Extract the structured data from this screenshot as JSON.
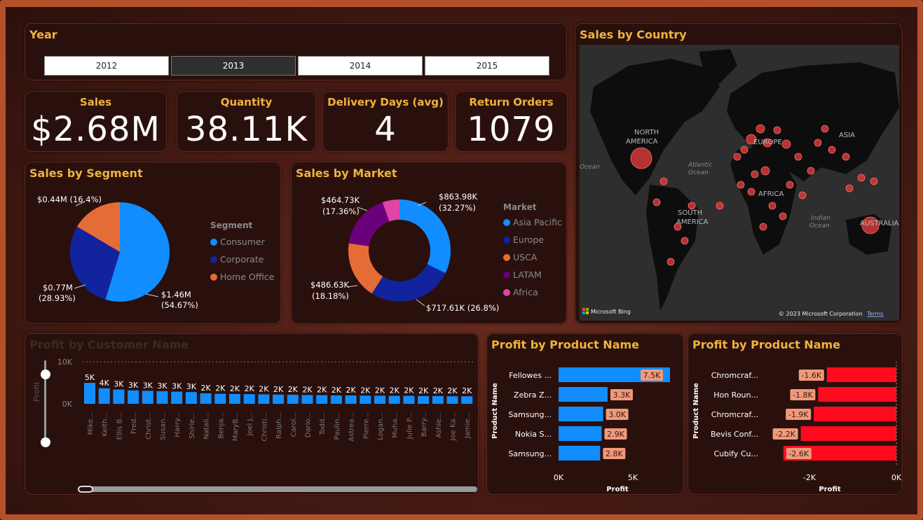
{
  "year_slicer": {
    "title": "Year",
    "options": [
      "2012",
      "2013",
      "2014",
      "2015"
    ],
    "selected": "2013"
  },
  "kpis": {
    "sales": {
      "label": "Sales",
      "value": "$2.68M"
    },
    "quantity": {
      "label": "Quantity",
      "value": "38.11K"
    },
    "delivery": {
      "label": "Delivery Days (avg)",
      "value": "4"
    },
    "returns": {
      "label": "Return Orders",
      "value": "1079"
    }
  },
  "segment": {
    "title": "Sales by Segment",
    "legend_title": "Segment",
    "legend": [
      "Consumer",
      "Corporate",
      "Home Office"
    ],
    "labels": {
      "consumer": [
        "$1.46M",
        "(54.67%)"
      ],
      "corporate": [
        "$0.77M",
        "(28.93%)"
      ],
      "home_office": "$0.44M (16.4%)"
    }
  },
  "market": {
    "title": "Sales by Market",
    "legend_title": "Market",
    "legend": [
      "Asia Pacific",
      "Europe",
      "USCA",
      "LATAM",
      "Africa"
    ],
    "labels": {
      "asia_pacific": [
        "$863.98K",
        "(32.27%)"
      ],
      "europe": "$717.61K (26.8%)",
      "usca": [
        "$486.63K",
        "(18.18%)"
      ],
      "latam": [
        "$464.73K",
        "(17.36%)"
      ]
    }
  },
  "map": {
    "title": "Sales by Country",
    "continents": [
      "NORTH",
      "AMERICA",
      "EUROPE",
      "ASIA",
      "AFRICA",
      "SOUTH",
      "AMERICA",
      "AUSTRALIA"
    ],
    "oceans": [
      "Atlantic",
      "Ocean",
      "Indian",
      "Ocean",
      "Ocean"
    ],
    "brand": "Microsoft Bing",
    "copyright": "© 2023 Microsoft Corporation",
    "terms": "Terms"
  },
  "customer_chart": {
    "title": "Profit by Customer Name",
    "ylabel": "Profit",
    "yticks": [
      "10K",
      "0K"
    ],
    "names": [
      "Mike...",
      "Keith...",
      "Ellis B...",
      "Fred...",
      "Christ...",
      "Susan...",
      "Harry...",
      "Shirle...",
      "Natali...",
      "Benja...",
      "MaryB...",
      "Joel J...",
      "Christi...",
      "Ralph...",
      "Carol...",
      "Dario...",
      "Todd...",
      "Paulin...",
      "Astrea...",
      "Pierre...",
      "Logan...",
      "Muha...",
      "Julie P...",
      "Barry...",
      "Ashle...",
      "Joe Ka...",
      "Jamie..."
    ],
    "value_labels": [
      "5K",
      "4K",
      "3K",
      "3K",
      "3K",
      "3K",
      "3K",
      "3K",
      "2K",
      "2K",
      "2K",
      "2K",
      "2K",
      "2K",
      "2K",
      "2K",
      "2K",
      "2K",
      "2K",
      "2K",
      "2K",
      "2K",
      "2K",
      "2K",
      "2K",
      "2K",
      "2K"
    ]
  },
  "product_top": {
    "title": "Profit by Product Name",
    "ylabel": "Product Name",
    "xlabel": "Profit",
    "xticks": [
      "0K",
      "5K"
    ],
    "names": [
      "Fellowes ...",
      "Zebra Z...",
      "Samsung...",
      "Nokia S...",
      "Samsung..."
    ],
    "labels": [
      "7.5K",
      "3.3K",
      "3.0K",
      "2.9K",
      "2.8K"
    ]
  },
  "product_bottom": {
    "title": "Profit by Product Name",
    "ylabel": "Product Name",
    "xlabel": "Profit",
    "xticks": [
      "-2K",
      "0K"
    ],
    "names": [
      "Chromcraf...",
      "Hon Roun...",
      "Chromcraf...",
      "Bevis Conf...",
      "Cubify Cu..."
    ],
    "labels": [
      "-1.6K",
      "-1.8K",
      "-1.9K",
      "-2.2K",
      "-2.6K"
    ]
  },
  "chart_data": [
    {
      "type": "pie",
      "title": "Sales by Segment",
      "categories": [
        "Consumer",
        "Corporate",
        "Home Office"
      ],
      "values": [
        1.46,
        0.77,
        0.44
      ],
      "percent": [
        54.67,
        28.93,
        16.4
      ],
      "colors": [
        "#118dff",
        "#12239e",
        "#e66c37"
      ],
      "legend": "right"
    },
    {
      "type": "pie",
      "title": "Sales by Market",
      "categories": [
        "Asia Pacific",
        "Europe",
        "USCA",
        "LATAM",
        "Africa"
      ],
      "values": [
        863.98,
        717.61,
        486.63,
        464.73,
        144.0
      ],
      "percent": [
        32.27,
        26.8,
        18.18,
        17.36,
        5.39
      ],
      "colors": [
        "#118dff",
        "#12239e",
        "#e66c37",
        "#6b007b",
        "#e044a7"
      ],
      "legend": "right"
    },
    {
      "type": "bar",
      "title": "Profit by Customer Name",
      "ylabel": "Profit",
      "ylim": [
        0,
        10000
      ],
      "categories": [
        "Mike...",
        "Keith...",
        "Ellis B...",
        "Fred...",
        "Christ...",
        "Susan...",
        "Harry...",
        "Shirle...",
        "Natali...",
        "Benja...",
        "MaryB...",
        "Joel J...",
        "Christi...",
        "Ralph...",
        "Carol...",
        "Dario...",
        "Todd...",
        "Paulin...",
        "Astrea...",
        "Pierre...",
        "Logan...",
        "Muha...",
        "Julie P...",
        "Barry...",
        "Ashle...",
        "Joe Ka...",
        "Jamie..."
      ],
      "values": [
        5000,
        3700,
        3400,
        3200,
        3100,
        3000,
        2900,
        2800,
        2500,
        2400,
        2350,
        2300,
        2250,
        2200,
        2150,
        2100,
        2050,
        2000,
        2000,
        1950,
        1950,
        1900,
        1900,
        1850,
        1850,
        1800,
        1800
      ]
    },
    {
      "type": "bar",
      "title": "Profit by Product Name",
      "xlabel": "Profit",
      "ylabel": "Product Name",
      "categories": [
        "Fellowes ...",
        "Zebra Z...",
        "Samsung...",
        "Nokia S...",
        "Samsung..."
      ],
      "values": [
        7500,
        3300,
        3000,
        2900,
        2800
      ]
    },
    {
      "type": "bar",
      "title": "Profit by Product Name",
      "xlabel": "Profit",
      "ylabel": "Product Name",
      "categories": [
        "Chromcraf...",
        "Hon Roun...",
        "Chromcraf...",
        "Bevis Conf...",
        "Cubify Cu..."
      ],
      "values": [
        -1600,
        -1800,
        -1900,
        -2200,
        -2600
      ]
    }
  ],
  "colors": {
    "accent_title": "#f0b33a",
    "bar_blue": "#118dff",
    "bar_red": "#ff0a1e",
    "label_orange": "#f0997b",
    "map_bubble": "#d43a3a"
  }
}
